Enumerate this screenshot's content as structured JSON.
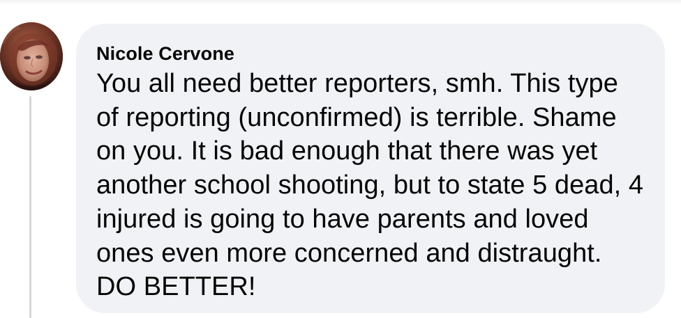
{
  "comment": {
    "author": "Nicole Cervone",
    "text": "You all need better reporters, smh. This type of reporting (unconfirmed) is terrible. Shame on you. It is bad enough that there was yet another school shooting, but to state 5 dead, 4 injured is going to have parents and loved ones even more concerned and distraught. DO BETTER!"
  },
  "colors": {
    "bubble": "#f0f2f5",
    "text": "#050505",
    "thread_line": "#d7d7d7",
    "background": "#ffffff"
  },
  "icons": {
    "avatar": "profile-photo"
  }
}
